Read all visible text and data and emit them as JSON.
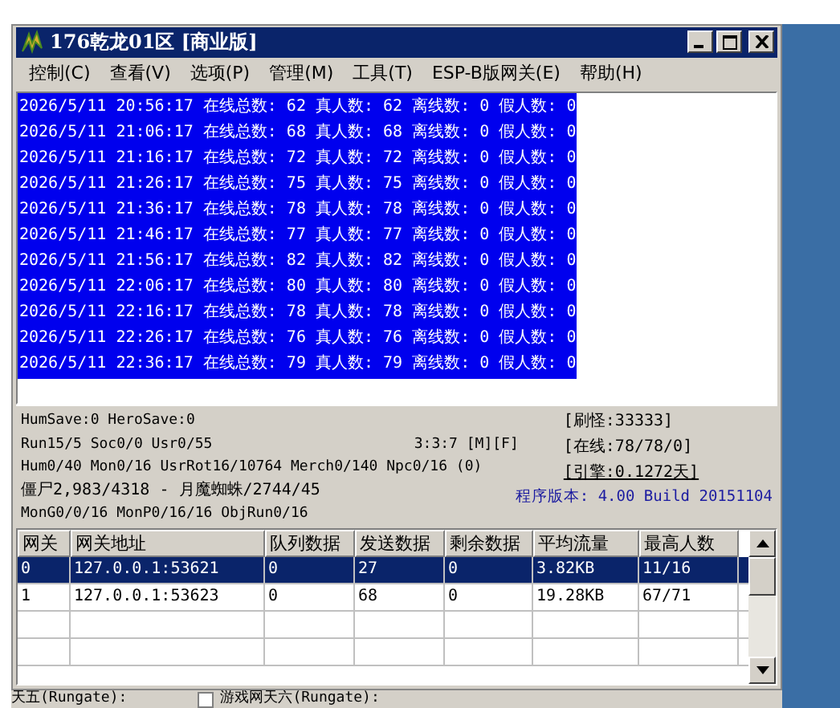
{
  "window": {
    "title": "176乾龙01区 [商业版]"
  },
  "menu": [
    "控制(C)",
    "查看(V)",
    "选项(P)",
    "管理(M)",
    "工具(T)",
    "ESP-B版网关(E)",
    "帮助(H)"
  ],
  "log": {
    "selected": true,
    "lines": [
      "2026/5/11 20:56:17 在线总数: 62 真人数: 62 离线数: 0 假人数: 0",
      "2026/5/11 21:06:17 在线总数: 68 真人数: 68 离线数: 0 假人数: 0",
      "2026/5/11 21:16:17 在线总数: 72 真人数: 72 离线数: 0 假人数: 0",
      "2026/5/11 21:26:17 在线总数: 75 真人数: 75 离线数: 0 假人数: 0",
      "2026/5/11 21:36:17 在线总数: 78 真人数: 78 离线数: 0 假人数: 0",
      "2026/5/11 21:46:17 在线总数: 77 真人数: 77 离线数: 0 假人数: 0",
      "2026/5/11 21:56:17 在线总数: 82 真人数: 82 离线数: 0 假人数: 0",
      "2026/5/11 22:06:17 在线总数: 80 真人数: 80 离线数: 0 假人数: 0",
      "2026/5/11 22:16:17 在线总数: 78 真人数: 78 离线数: 0 假人数: 0",
      "2026/5/11 22:26:17 在线总数: 76 真人数: 76 离线数: 0 假人数: 0",
      "2026/5/11 22:36:17 在线总数: 79 真人数: 79 离线数: 0 假人数: 0"
    ]
  },
  "stats": {
    "left": [
      "HumSave:0 HeroSave:0",
      "Run15/5 Soc0/0 Usr0/55",
      "Hum0/40 Mon0/16 UsrRot16/10764 Merch0/140 Npc0/16 (0)",
      "僵尸2,983/4318 - 月魔蜘蛛/2744/45",
      "MonG0/0/16 MonP0/16/16 ObjRun0/16"
    ],
    "mode": "3:3:7 [M][F]",
    "right": [
      "[刷怪:33333]",
      "[在线:78/78/0]",
      "[引擎:0.1272天]"
    ],
    "version": "程序版本: 4.00 Build 20151104"
  },
  "table": {
    "columns": [
      "网关",
      "网关地址",
      "队列数据",
      "发送数据",
      "剩余数据",
      "平均流量",
      "最高人数"
    ],
    "rows": [
      {
        "selected": true,
        "cells": [
          "0",
          "127.0.0.1:53621",
          "0",
          "27",
          "0",
          "3.82KB",
          "11/16"
        ]
      },
      {
        "selected": false,
        "cells": [
          "1",
          "127.0.0.1:53623",
          "0",
          "68",
          "0",
          "19.28KB",
          "67/71"
        ]
      }
    ]
  },
  "background_strip": [
    {
      "kind": "label",
      "text": "天五(Rungate):"
    },
    {
      "kind": "checkbox",
      "checked": false,
      "text": "游戏网天六(Rungate):"
    }
  ]
}
